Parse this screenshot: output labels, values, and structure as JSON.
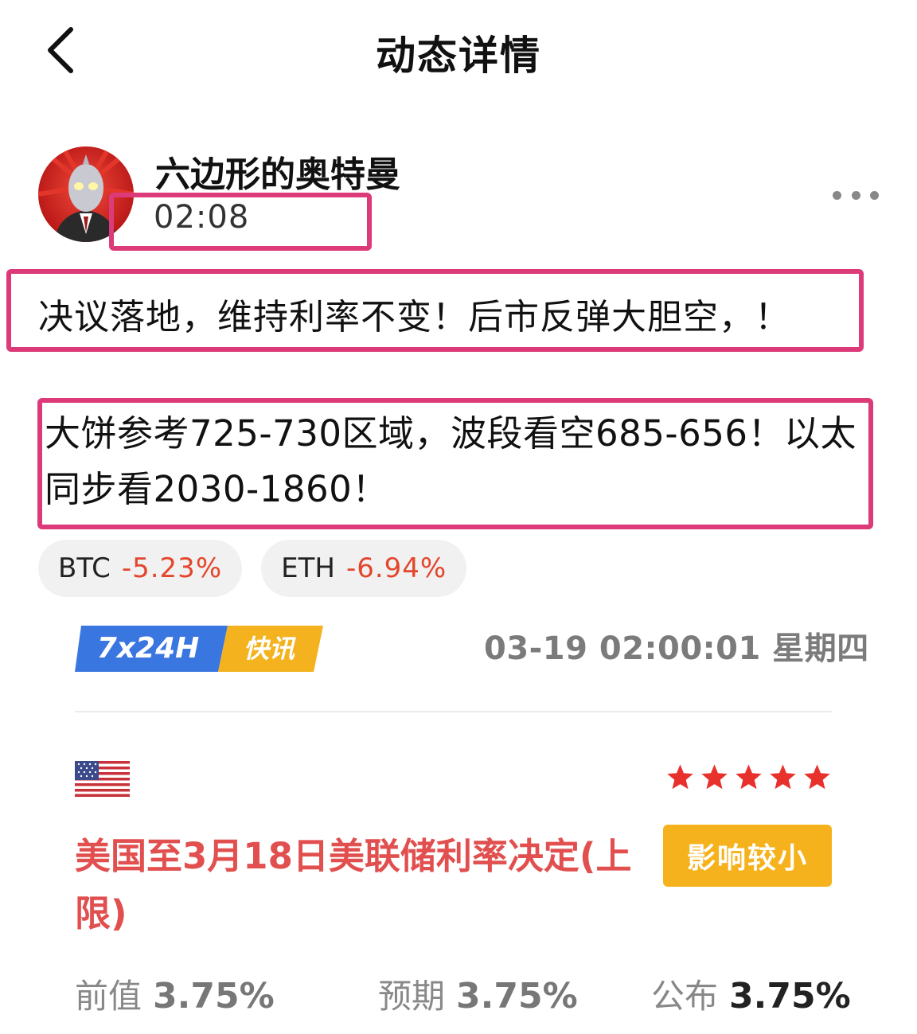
{
  "header": {
    "title": "动态详情",
    "back_icon": "chevron-left-icon"
  },
  "author": {
    "name": "六边形的奥特曼",
    "time": "02:08",
    "avatar_icon": "ultraman-avatar"
  },
  "menu": {
    "icon": "more-horizontal-icon"
  },
  "post": {
    "line1": "决议落地，维持利率不变！后市反弹大胆空，！",
    "line2": "大饼参考725-730区域，波段看空685-656！以太同步看2030-1860！"
  },
  "tags": [
    {
      "symbol": "BTC",
      "change": "-5.23%"
    },
    {
      "symbol": "ETH",
      "change": "-6.94%"
    }
  ],
  "flash": {
    "logo_left": "7x24H",
    "logo_right": "快讯",
    "datetime": "03-19 02:00:01 星期四"
  },
  "event": {
    "flag_icon": "us-flag-icon",
    "stars": 5,
    "title": "美国至3月18日美联储利率决定(上限)",
    "impact": "影响较小",
    "previous_label": "前值",
    "previous_value": "3.75%",
    "expected_label": "预期",
    "expected_value": "3.75%",
    "actual_label": "公布",
    "actual_value": "3.75%"
  },
  "colors": {
    "highlight": "#dc3a78",
    "negative": "#e3462c",
    "event_title": "#e14f4f",
    "impact_badge": "#f5b21c",
    "star": "#e8312c"
  }
}
